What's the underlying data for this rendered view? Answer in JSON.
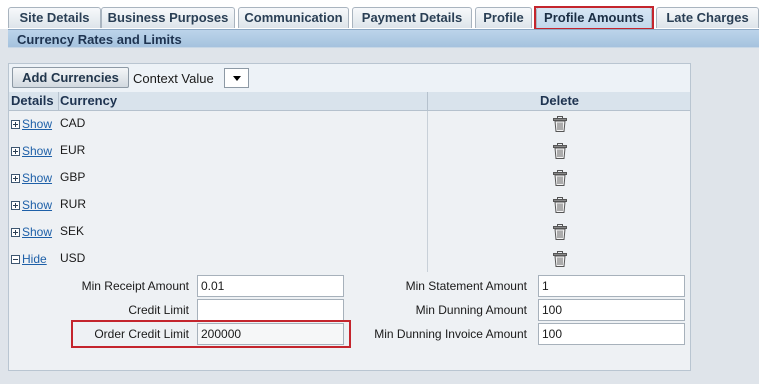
{
  "tabs": [
    {
      "label": "Site Details"
    },
    {
      "label": "Business Purposes"
    },
    {
      "label": "Communication"
    },
    {
      "label": "Payment Details"
    },
    {
      "label": "Profile"
    },
    {
      "label": "Profile Amounts",
      "active": true
    },
    {
      "label": "Late Charges"
    }
  ],
  "section": {
    "title": "Currency Rates and Limits"
  },
  "toolbar": {
    "add_label": "Add Currencies",
    "context_label": "Context Value",
    "context_value": ""
  },
  "table": {
    "headers": {
      "details": "Details",
      "currency": "Currency",
      "delete": "Delete"
    },
    "rows": [
      {
        "toggle": "Show",
        "currency": "CAD"
      },
      {
        "toggle": "Show",
        "currency": "EUR"
      },
      {
        "toggle": "Show",
        "currency": "GBP"
      },
      {
        "toggle": "Show",
        "currency": "RUR"
      },
      {
        "toggle": "Show",
        "currency": "SEK"
      },
      {
        "toggle": "Hide",
        "currency": "USD"
      }
    ]
  },
  "detail": {
    "min_receipt_amount": {
      "label": "Min Receipt Amount",
      "value": "0.01"
    },
    "credit_limit": {
      "label": "Credit Limit",
      "value": ""
    },
    "order_credit_limit": {
      "label": "Order Credit Limit",
      "value": "200000"
    },
    "min_statement_amount": {
      "label": "Min Statement Amount",
      "value": "1"
    },
    "min_dunning_amount": {
      "label": "Min Dunning Amount",
      "value": "100"
    },
    "min_dunning_invoice_amount": {
      "label": "Min Dunning Invoice Amount",
      "value": "100"
    }
  },
  "colors": {
    "highlight": "#c4252d",
    "link": "#1e60a8",
    "header": "#1e3350"
  },
  "icons": {
    "delete": "trash-icon",
    "expand": "plus-box-icon",
    "collapse": "minus-box-icon",
    "dropdown": "chevron-down-icon"
  }
}
